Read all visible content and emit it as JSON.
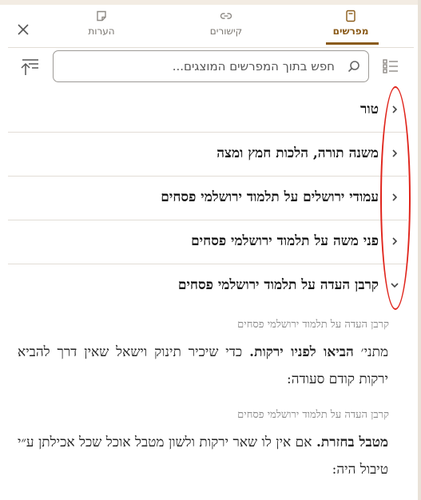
{
  "tabs": {
    "commentaries": {
      "label": "מפרשים",
      "icon": "book-icon"
    },
    "links": {
      "label": "קישורים",
      "icon": "link-icon"
    },
    "notes": {
      "label": "הערות",
      "icon": "note-icon"
    }
  },
  "search": {
    "placeholder": "חפש בתוך המפרשים המוצגים..."
  },
  "commentators": [
    {
      "label": "טור",
      "expanded": false
    },
    {
      "label": "משנה תורה, הלכות חמץ ומצה",
      "expanded": false
    },
    {
      "label": "עמודי ירושלים על תלמוד ירושלמי פסחים",
      "expanded": false
    },
    {
      "label": "פני משה על תלמוד ירושלמי פסחים",
      "expanded": false
    },
    {
      "label": "קרבן העדה על תלמוד ירושלמי פסחים",
      "expanded": true
    }
  ],
  "entries": [
    {
      "source": "קרבן העדה על תלמוד ירושלמי פסחים",
      "prefix": "מתני׳",
      "bold": "הביאו לפניו ירקות.",
      "text": "כדי שיכיר תינוק וישאל שאין דרך להביא ירקות קודם סעודה:"
    },
    {
      "source": "קרבן העדה על תלמוד ירושלמי פסחים",
      "prefix": "",
      "bold": "מטבל בחזרת.",
      "text": "אם אין לו שאר ירקות ולשון מטבל אוכל שכל אכילתן ע״י טיבול היה:"
    }
  ],
  "colors": {
    "accent": "#8a5a18",
    "annotation": "#e0241b"
  }
}
